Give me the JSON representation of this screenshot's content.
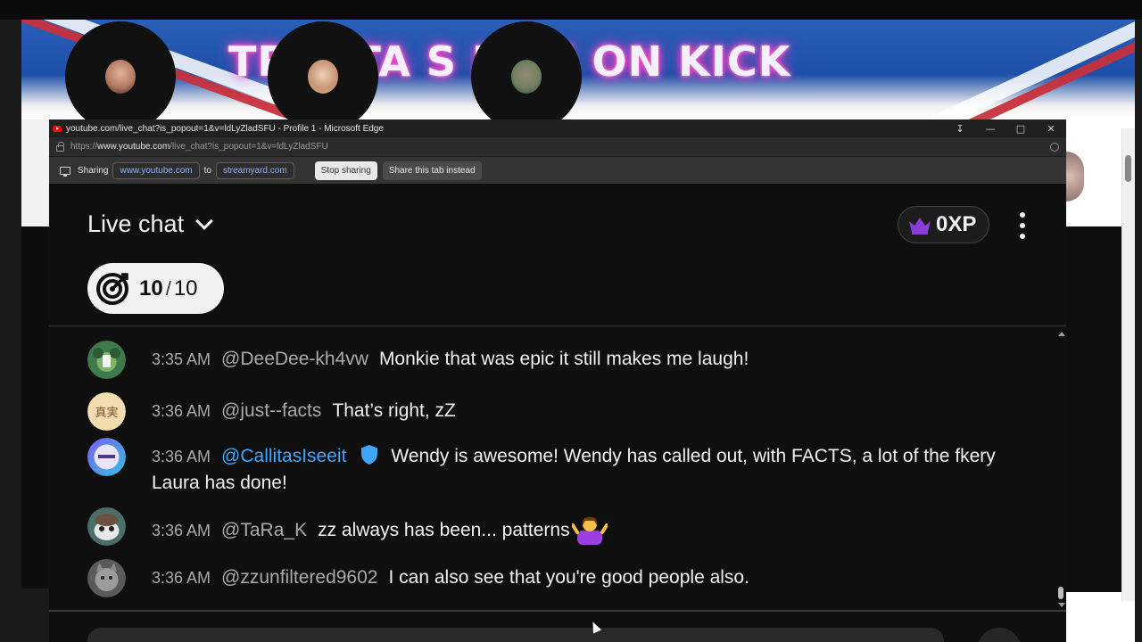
{
  "stream": {
    "banner_text": "TR    A TA    S LIVE ON KICK"
  },
  "window": {
    "title": "youtube.com/live_chat?is_popout=1&v=ldLyZladSFU - Profile 1 - Microsoft Edge",
    "url_prefix": "https://",
    "url_host": "www.youtube.com",
    "url_path": "/live_chat?is_popout=1&v=ldLyZladSFU"
  },
  "sharebar": {
    "label": "Sharing",
    "source": "www.youtube.com",
    "to": "to",
    "target": "streamyard.com",
    "stop_label": "Stop sharing",
    "switch_label": "Share this tab instead"
  },
  "chat": {
    "title": "Live chat",
    "xp_label": "0XP",
    "goal": {
      "current": "10",
      "separator": "/",
      "total": "10"
    },
    "messages": [
      {
        "time": "3:35 AM",
        "author": "@DeeDee-kh4vw",
        "text": "Monkie that was epic it still makes me laugh!",
        "member": false
      },
      {
        "time": "3:36 AM",
        "author": "@just--facts",
        "text": "That’s right, zZ",
        "member": false
      },
      {
        "time": "3:36 AM",
        "author": "@CallitasIseeit",
        "text": "Wendy is awesome! Wendy has called out, with FACTS, a lot of the fkery Laura has done!",
        "member": true
      },
      {
        "time": "3:36 AM",
        "author": "@TaRa_K",
        "text": "zz always has been... patterns",
        "member": false
      },
      {
        "time": "3:36 AM",
        "author": "@zzunfiltered9602",
        "text": "I can also see that you're good people also.",
        "member": false
      }
    ]
  },
  "colors": {
    "chat_bg": "#0f0f0f",
    "text": "#f1f1f1",
    "secondary_text": "#aaaaaa",
    "member_author": "#3ea6ff",
    "link_chip": "#8ab4f8",
    "crown": "#8b3ddb"
  }
}
